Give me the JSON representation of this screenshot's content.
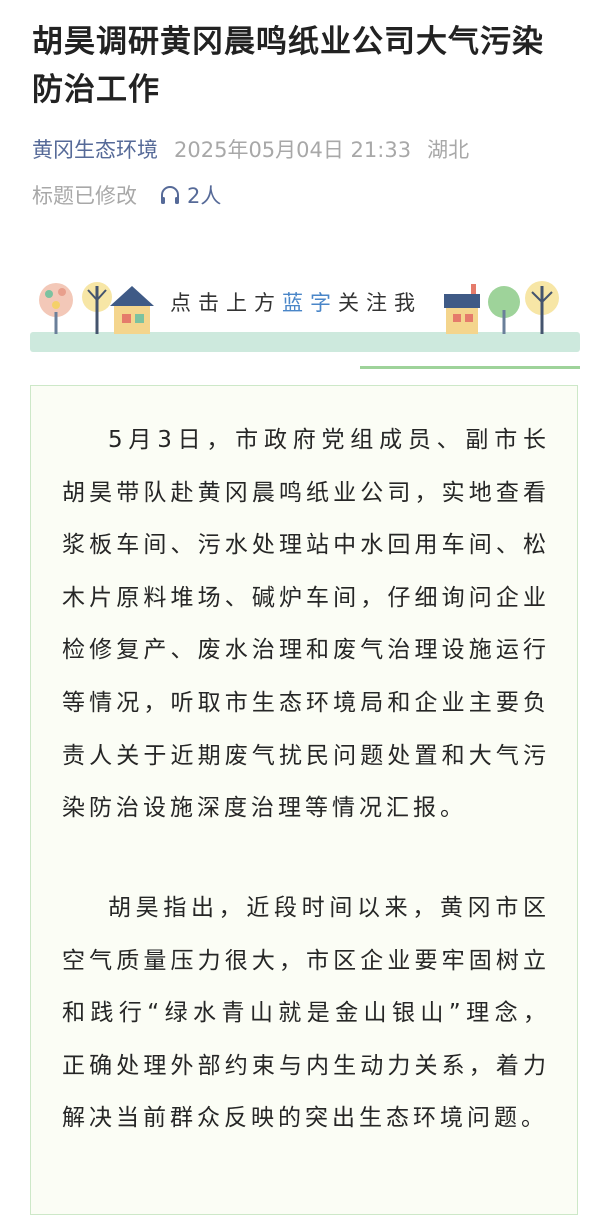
{
  "article": {
    "title": "胡昊调研黄冈晨鸣纸业公司大气污染防治工作",
    "account": "黄冈生态环境",
    "time": "2025年05月04日 21:33",
    "location": "湖北",
    "edited_note": "标题已修改",
    "listeners": "2人"
  },
  "banner": {
    "text_before": "点击上方",
    "text_highlight": "蓝字",
    "text_after": "关注我"
  },
  "body": {
    "paragraph1": "5月3日，市政府党组成员、副市长胡昊带队赴黄冈晨鸣纸业公司，实地查看浆板车间、污水处理站中水回用车间、松木片原料堆场、碱炉车间，仔细询问企业检修复产、废水治理和废气治理设施运行等情况，听取市生态环境局和企业主要负责人关于近期废气扰民问题处置和大气污染防治设施深度治理等情况汇报。",
    "paragraph2": "胡昊指出，近段时间以来，黄冈市区空气质量压力很大，市区企业要牢固树立和践行“绿水青山就是金山银山”理念，正确处理外部约束与内生动力关系，着力解决当前群众反映的突出生态环境问题。"
  },
  "colors": {
    "account_blue": "#566a98",
    "highlight_blue": "#4a86c8",
    "card_border": "#cde8c8",
    "accent_green": "#9ed39a"
  }
}
